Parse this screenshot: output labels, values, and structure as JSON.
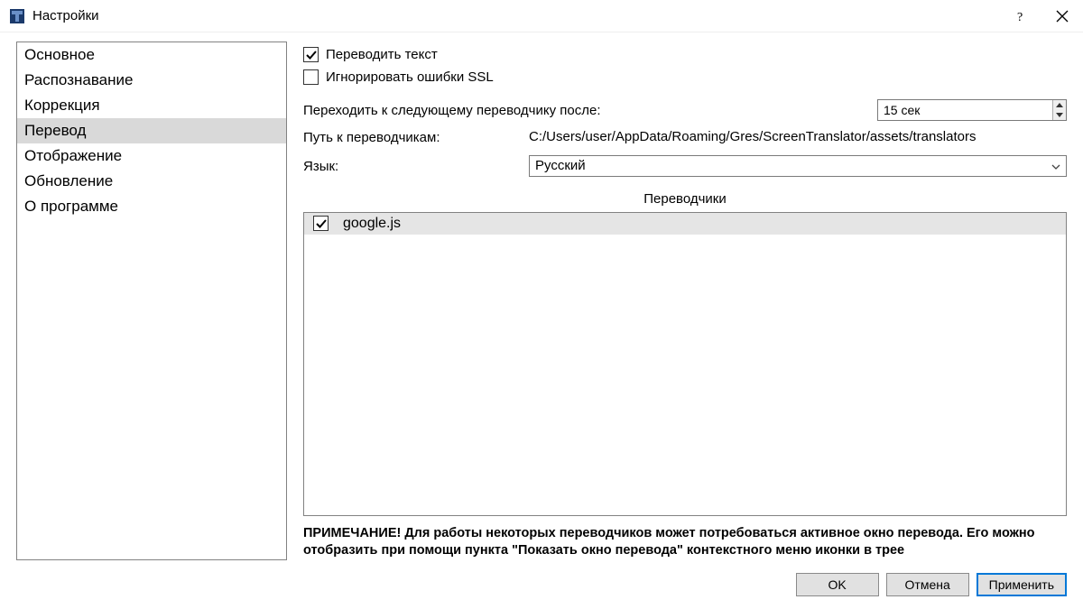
{
  "titlebar": {
    "title": "Настройки"
  },
  "sidebar": {
    "items": [
      {
        "label": "Основное",
        "selected": false
      },
      {
        "label": "Распознавание",
        "selected": false
      },
      {
        "label": "Коррекция",
        "selected": false
      },
      {
        "label": "Перевод",
        "selected": true
      },
      {
        "label": "Отображение",
        "selected": false
      },
      {
        "label": "Обновление",
        "selected": false
      },
      {
        "label": "О программе",
        "selected": false
      }
    ]
  },
  "main": {
    "translate_text": {
      "label": "Переводить текст",
      "checked": true
    },
    "ignore_ssl": {
      "label": "Игнорировать ошибки SSL",
      "checked": false
    },
    "next_translator_label": "Переходить к следующему переводчику после:",
    "next_translator_value": "15 сек",
    "translators_path_label": "Путь к переводчикам:",
    "translators_path_value": "C:/Users/user/AppData/Roaming/Gres/ScreenTranslator/assets/translators",
    "language_label": "Язык:",
    "language_value": "Русский",
    "translators_heading": "Переводчики",
    "translators": [
      {
        "label": "google.js",
        "checked": true
      }
    ],
    "note": "ПРИМЕЧАНИЕ! Для работы некоторых переводчиков может потребоваться активное окно перевода. Его можно отобразить при помощи пункта \"Показать окно перевода\" контекстного меню иконки в трее"
  },
  "footer": {
    "ok": "OK",
    "cancel": "Отмена",
    "apply": "Применить"
  }
}
